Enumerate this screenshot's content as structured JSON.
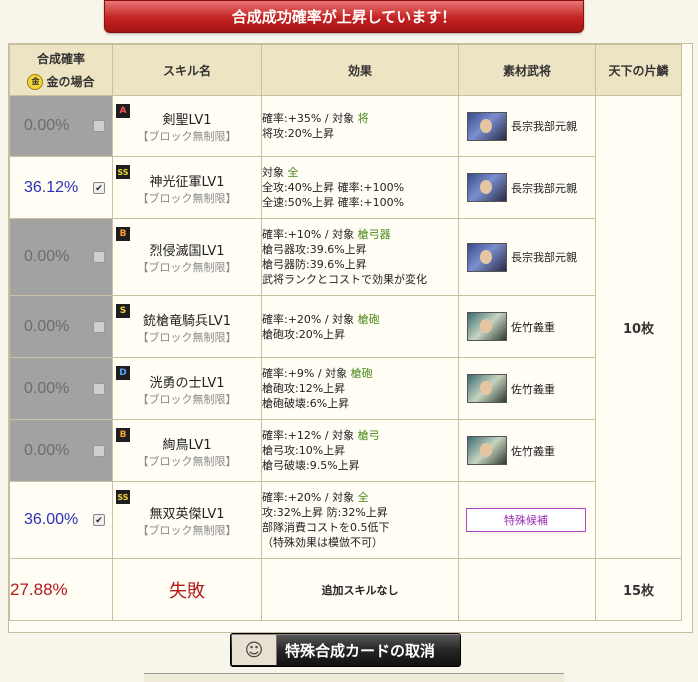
{
  "banner": "合成成功確率が上昇しています！",
  "headers": {
    "rate": "合成確率",
    "gold": "金の場合",
    "skill": "スキル名",
    "effect": "効果",
    "material": "素材武将",
    "tenka": "天下の片鱗"
  },
  "rows": [
    {
      "rate": "0.00%",
      "checked": false,
      "rank": "A",
      "skill": "剣聖LV1",
      "sub": "【ブロック無制限】",
      "effect": [
        "確率:+35% / 対象 将",
        "将攻:20%上昇"
      ],
      "material": "長宗我部元親"
    },
    {
      "rate": "36.12%",
      "checked": true,
      "rank": "SS",
      "skill": "神光征軍LV1",
      "sub": "【ブロック無制限】",
      "effect": [
        "対象 全",
        "全攻:40%上昇 確率:+100%",
        "全速:50%上昇 確率:+100%"
      ],
      "material": "長宗我部元親"
    },
    {
      "rate": "0.00%",
      "checked": false,
      "rank": "B",
      "skill": "烈侵滅国LV1",
      "sub": "【ブロック無制限】",
      "effect": [
        "確率:+10% / 対象 槍弓器",
        "槍弓器攻:39.6%上昇",
        "槍弓器防:39.6%上昇",
        "武将ランクとコストで効果が変化"
      ],
      "material": "長宗我部元親"
    },
    {
      "rate": "0.00%",
      "checked": false,
      "rank": "S",
      "skill": "銃槍竜騎兵LV1",
      "sub": "【ブロック無制限】",
      "effect": [
        "確率:+20% / 対象 槍砲",
        "槍砲攻:20%上昇"
      ],
      "material": "佐竹義重"
    },
    {
      "rate": "0.00%",
      "checked": false,
      "rank": "D",
      "skill": "洸勇の士LV1",
      "sub": "【ブロック無制限】",
      "effect": [
        "確率:+9% / 対象 槍砲",
        "槍砲攻:12%上昇",
        "槍砲破壊:6%上昇"
      ],
      "material": "佐竹義重"
    },
    {
      "rate": "0.00%",
      "checked": false,
      "rank": "B",
      "skill": "絢鳥LV1",
      "sub": "【ブロック無制限】",
      "effect": [
        "確率:+12% / 対象 槍弓",
        "槍弓攻:10%上昇",
        "槍弓破壊:9.5%上昇"
      ],
      "material": "佐竹義重"
    },
    {
      "rate": "36.00%",
      "checked": true,
      "rank": "SS",
      "skill": "無双英傑LV1",
      "sub": "【ブロック無制限】",
      "effect": [
        "確率:+20% / 対象 全",
        "攻:32%上昇 防:32%上昇",
        "部隊消費コストを0.5低下",
        "（特殊効果は模倣不可）"
      ],
      "material": "特殊候補"
    }
  ],
  "tenka_count": "10枚",
  "fail": {
    "rate": "27.88%",
    "label": "失敗",
    "effect": "追加スキルなし",
    "count": "15枚"
  },
  "cancel_button": "特殊合成カードの取消"
}
